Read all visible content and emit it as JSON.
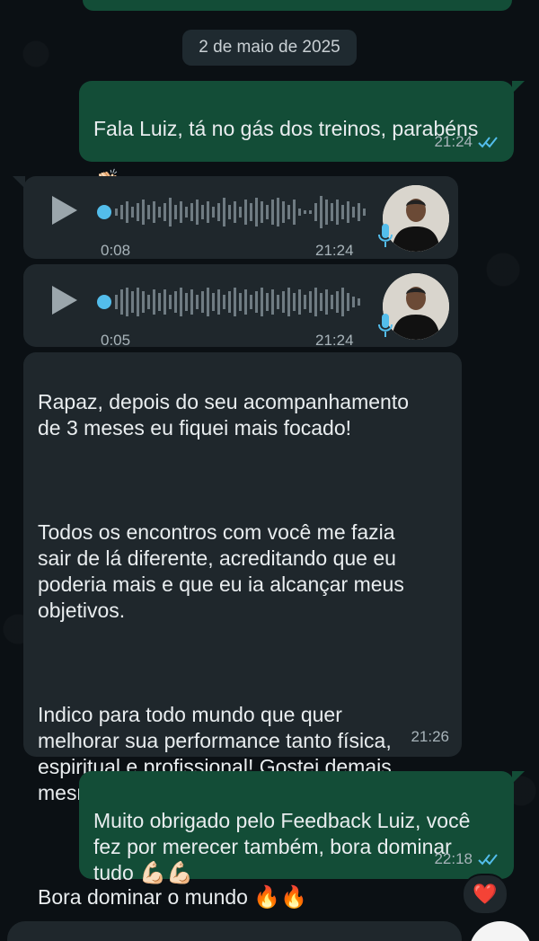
{
  "date_separator": "2 de maio de 2025",
  "messages": {
    "m1": {
      "text": "Fala Luiz, tá no gás dos treinos, parabéns",
      "emoji": "👏🏻",
      "time": "21:24"
    },
    "voice1": {
      "duration": "0:08",
      "time": "21:24"
    },
    "voice2": {
      "duration": "0:05",
      "time": "21:24"
    },
    "m2": {
      "p1": "Rapaz, depois do seu acompanhamento\nde 3 meses eu fiquei mais focado!",
      "p2": "Todos os encontros com você me fazia\nsair de lá diferente, acreditando que eu\npoderia mais e que eu ia alcançar meus\nobjetivos.",
      "p3": "Indico para todo mundo que quer\nmelhorar sua performance tanto física,\nespiritual e profissional! Gostei demais\nmesmo",
      "p3_emoji": "✅🔥",
      "p4": "Bora dominar o mundo",
      "p4_emoji": "🔥🔥",
      "time": "21:26"
    },
    "m3": {
      "text": "Muito obrigado pelo Feedback Luiz, você\nfez por merecer também, bora dominar\ntudo",
      "emoji": "💪🏻💪🏻",
      "time": "22:18",
      "reaction": "❤️"
    }
  },
  "colors": {
    "outgoing": "#134d37",
    "incoming": "#1f272c",
    "read_ticks": "#53bdeb",
    "background": "#0b1014"
  }
}
